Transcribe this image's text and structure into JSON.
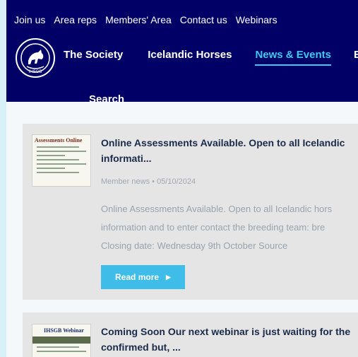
{
  "topnav": [
    "Join us",
    "Area reps",
    "Members' Area",
    "Contact us",
    "Webinars"
  ],
  "logo_text": "IHSGB",
  "mainnav": [
    "The Society",
    "Icelandic Horses",
    "News & Events",
    "E"
  ],
  "search_label": "Search",
  "posts": [
    {
      "thumb_title": "Assessments Online",
      "title_line1": "Online Assessments Available. Open to all Icelandic",
      "title_line2": "informati...",
      "meta": "Member news • 05/10/2024",
      "excerpt_line1": "Online Assessments Available. Open to all Icelandic hors",
      "excerpt_line2": "information and to enter contact the breeding team: bre",
      "excerpt_line3": "Closing date: Wednesday 9th October Source",
      "readmore_label": "Read more",
      "readmore_arrow": "▶"
    },
    {
      "thumb_title": "IHSGB Webinar",
      "title_line1": "Coming Soon Our next webinar is just waiting for the",
      "title_line2": "confirmed but, ..."
    }
  ]
}
